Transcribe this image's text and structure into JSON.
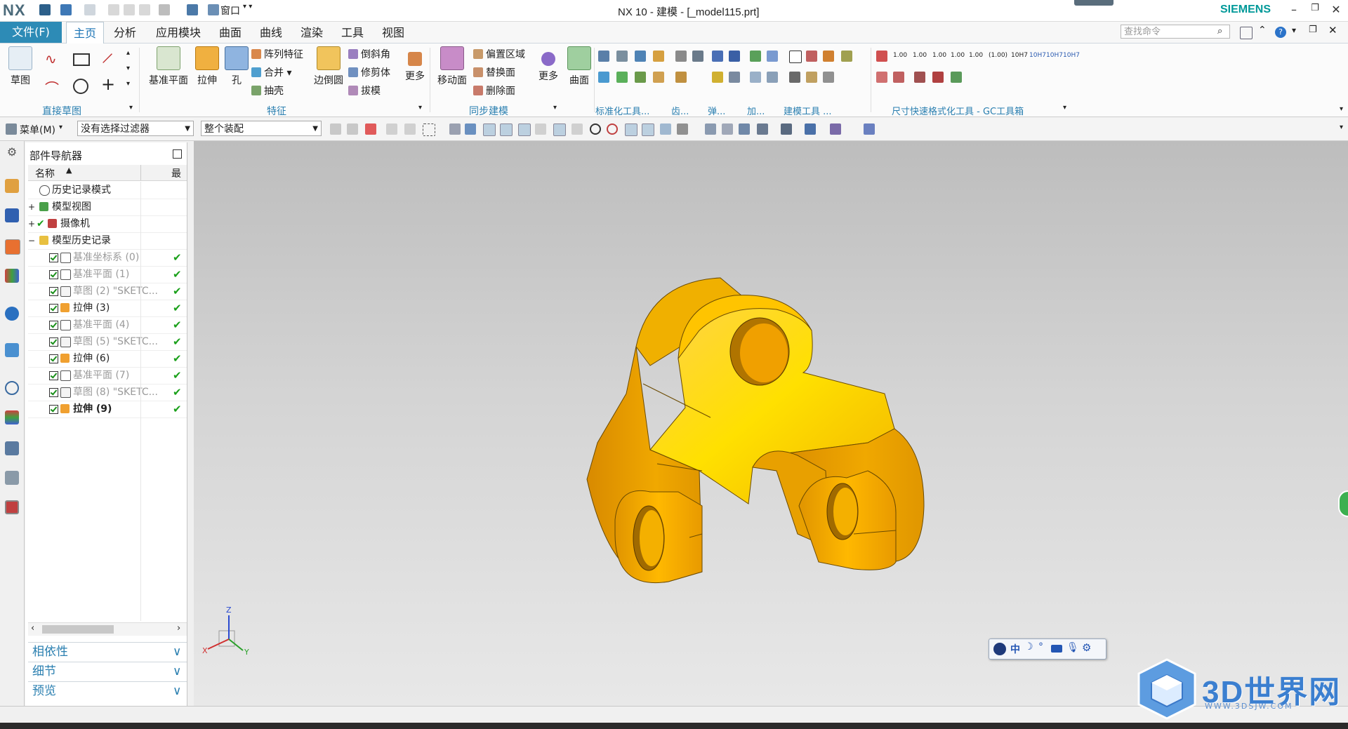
{
  "window": {
    "logo": "NX",
    "title": "NX 10 - 建模 - [_model115.prt]",
    "brand": "SIEMENS",
    "quick_access_window_menu": "窗口"
  },
  "ribbon_tabs": {
    "file": "文件(F)",
    "tabs": [
      "主页",
      "分析",
      "应用模块",
      "曲面",
      "曲线",
      "渲染",
      "工具",
      "视图"
    ],
    "active": "主页",
    "search_placeholder": "查找命令"
  },
  "ribbon": {
    "sketch": {
      "label": "草图",
      "group": "直接草图"
    },
    "feature": {
      "datum_plane": "基准平面",
      "extrude": "拉伸",
      "hole": "孔",
      "pattern": "阵列特征",
      "unite": "合并",
      "shell": "抽壳",
      "edge_blend": "边倒圆",
      "chamfer": "倒斜角",
      "trim_body": "修剪体",
      "draft": "拔模",
      "more": "更多",
      "group": "特征"
    },
    "sync": {
      "move_face": "移动面",
      "offset_region": "偏置区域",
      "replace_face": "替换面",
      "delete_face": "删除面",
      "more": "更多",
      "group": "同步建模"
    },
    "surface": {
      "label": "曲面"
    },
    "groups_right": [
      "标准化工具...",
      "齿...",
      "弹...",
      "加...",
      "建模工具 ...",
      "尺寸快速格式化工具 - GC工具箱"
    ],
    "dim_labels": [
      "1.00",
      "1.00",
      "1.00",
      "1.00",
      "1.00",
      "(1.00)",
      "10H7",
      "10H7",
      "10H7",
      "10H7"
    ]
  },
  "toolbar2": {
    "menu": "菜单(M)",
    "filter": "没有选择过滤器",
    "scope": "整个装配"
  },
  "navigator": {
    "title": "部件导航器",
    "col_name": "名称",
    "col_latest": "最",
    "rows": [
      {
        "label": "历史记录模式",
        "level": 0,
        "style": "normal"
      },
      {
        "label": "模型视图",
        "level": 0,
        "style": "normal"
      },
      {
        "label": "摄像机",
        "level": 0,
        "style": "normal"
      },
      {
        "label": "模型历史记录",
        "level": 0,
        "style": "normal"
      },
      {
        "label": "基准坐标系 (0)",
        "level": 1,
        "style": "gray"
      },
      {
        "label": "基准平面 (1)",
        "level": 1,
        "style": "gray"
      },
      {
        "label": "草图 (2) \"SKETC...",
        "level": 1,
        "style": "gray"
      },
      {
        "label": "拉伸 (3)",
        "level": 1,
        "style": "normal"
      },
      {
        "label": "基准平面 (4)",
        "level": 1,
        "style": "gray"
      },
      {
        "label": "草图 (5) \"SKETC...",
        "level": 1,
        "style": "gray"
      },
      {
        "label": "拉伸 (6)",
        "level": 1,
        "style": "normal"
      },
      {
        "label": "基准平面 (7)",
        "level": 1,
        "style": "gray"
      },
      {
        "label": "草图 (8) \"SKETC...",
        "level": 1,
        "style": "gray"
      },
      {
        "label": "拉伸 (9)",
        "level": 1,
        "style": "bold"
      }
    ],
    "panels": [
      "相依性",
      "细节",
      "预览"
    ]
  },
  "triad": {
    "z": "Z",
    "x": "X",
    "y": "Y"
  },
  "ime": {
    "label": "中"
  },
  "watermark": {
    "text": "3D世界网",
    "url": "WWW.3DSJW.COM"
  },
  "colors": {
    "accent": "#2d8bb6",
    "part": "#f2a900"
  }
}
